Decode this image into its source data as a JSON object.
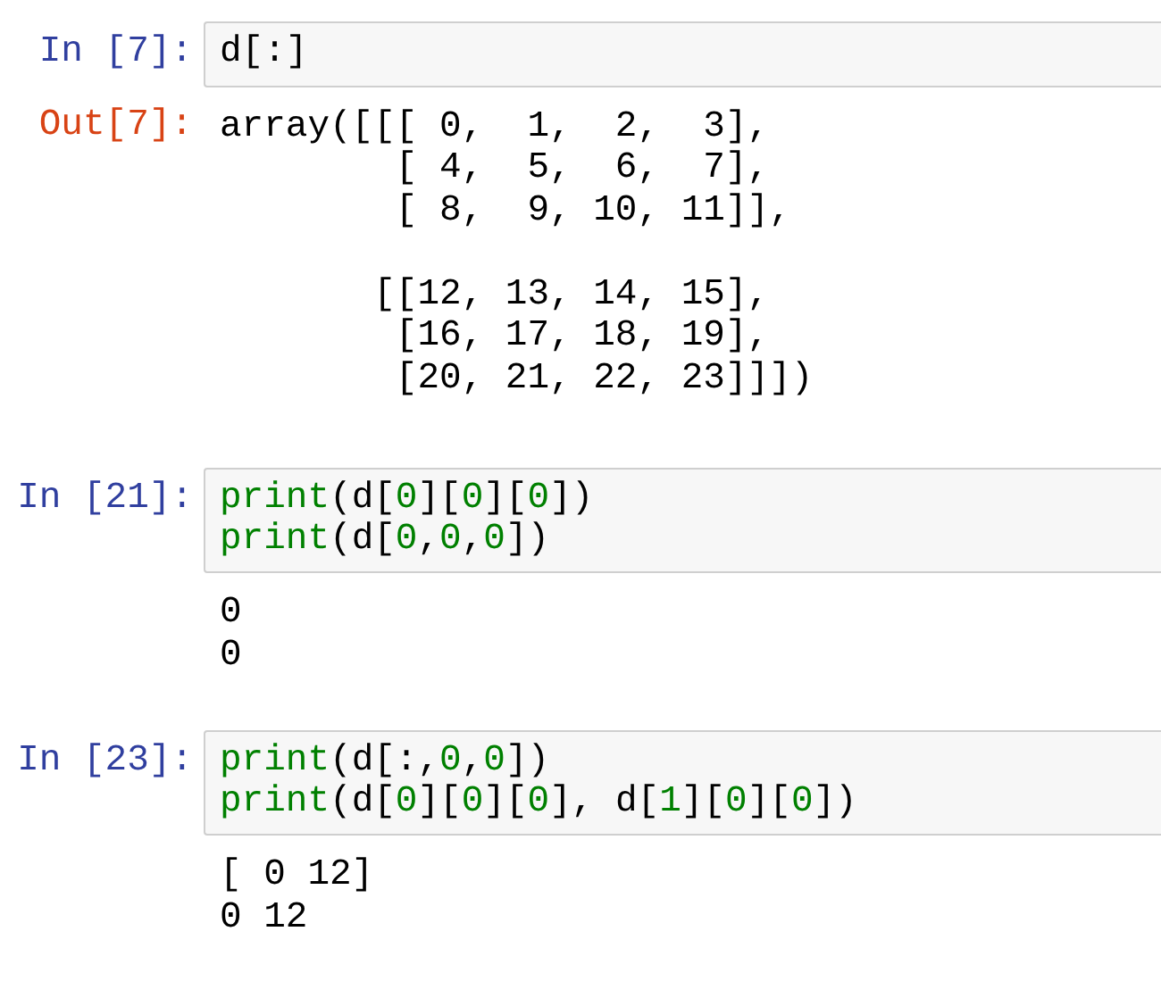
{
  "cells": [
    {
      "in_prompt": "In [7]:",
      "code": [
        "d[:]"
      ],
      "out_prompt": "Out[7]:",
      "output": "array([[[ 0,  1,  2,  3],\n        [ 4,  5,  6,  7],\n        [ 8,  9, 10, 11]],\n\n       [[12, 13, 14, 15],\n        [16, 17, 18, 19],\n        [20, 21, 22, 23]]])"
    },
    {
      "in_prompt": "In [21]:",
      "code": [
        "print(d[0][0][0])",
        "print(d[0,0,0])"
      ],
      "output": "0\n0"
    },
    {
      "in_prompt": "In [23]:",
      "code": [
        "print(d[:,0,0])",
        "print(d[0][0][0], d[1][0][0])"
      ],
      "output": "[ 0 12]\n0 12"
    }
  ]
}
